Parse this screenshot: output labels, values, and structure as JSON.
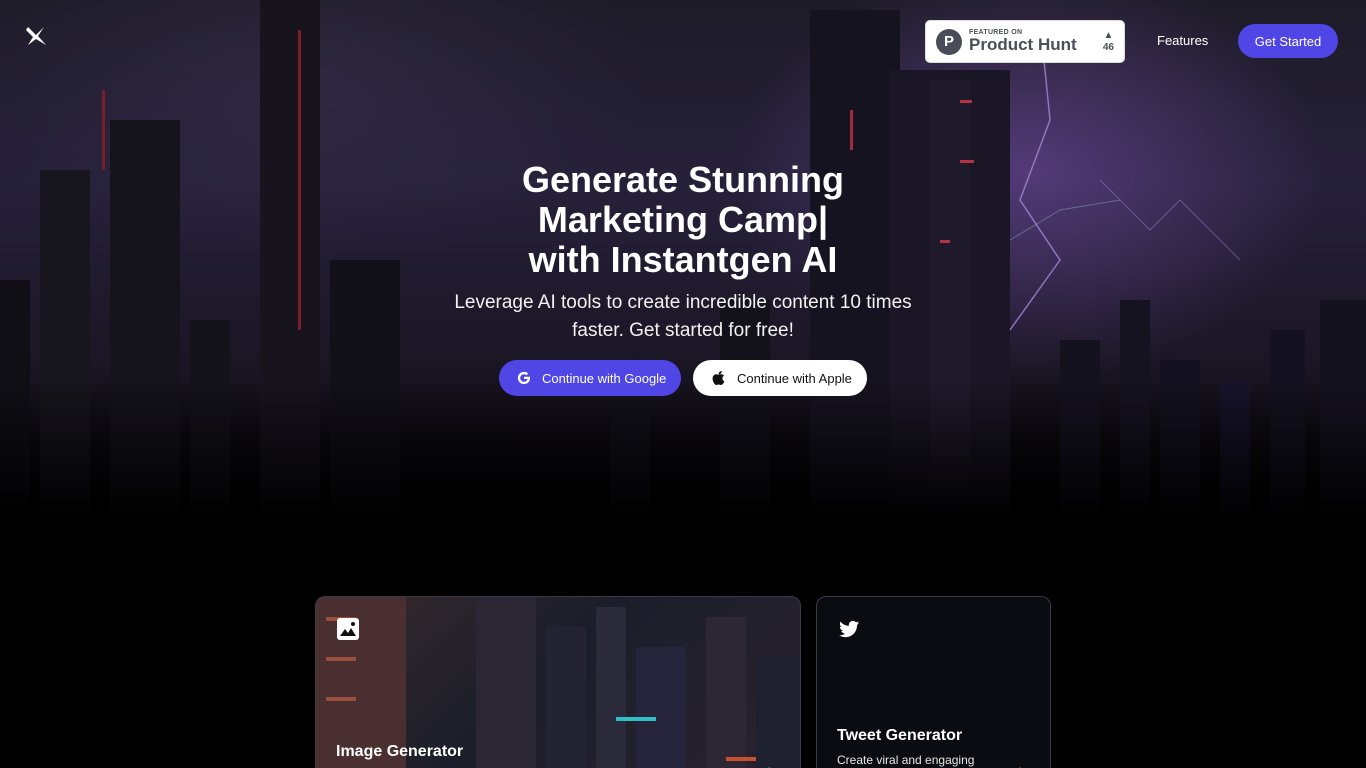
{
  "nav": {
    "logo_icon": "bolt-x-logo",
    "product_hunt": {
      "featured": "FEATURED ON",
      "name": "Product Hunt",
      "votes": "46",
      "letter": "P"
    },
    "features_label": "Features",
    "get_started_label": "Get Started"
  },
  "hero": {
    "headline_line1": "Generate Stunning",
    "headline_line2": "Marketing Camp|",
    "headline_line3": "with Instantgen AI",
    "subtext": "Leverage AI tools to create incredible content 10 times faster. Get started for free!",
    "google_label": "Continue with Google",
    "apple_label": "Continue with Apple"
  },
  "cards": [
    {
      "title": "Image Generator",
      "icon": "image-icon"
    },
    {
      "title": "Tweet Generator",
      "description": "Create viral and engaging",
      "icon": "twitter-icon"
    }
  ],
  "colors": {
    "accent": "#4f46e5",
    "background": "#000000"
  }
}
